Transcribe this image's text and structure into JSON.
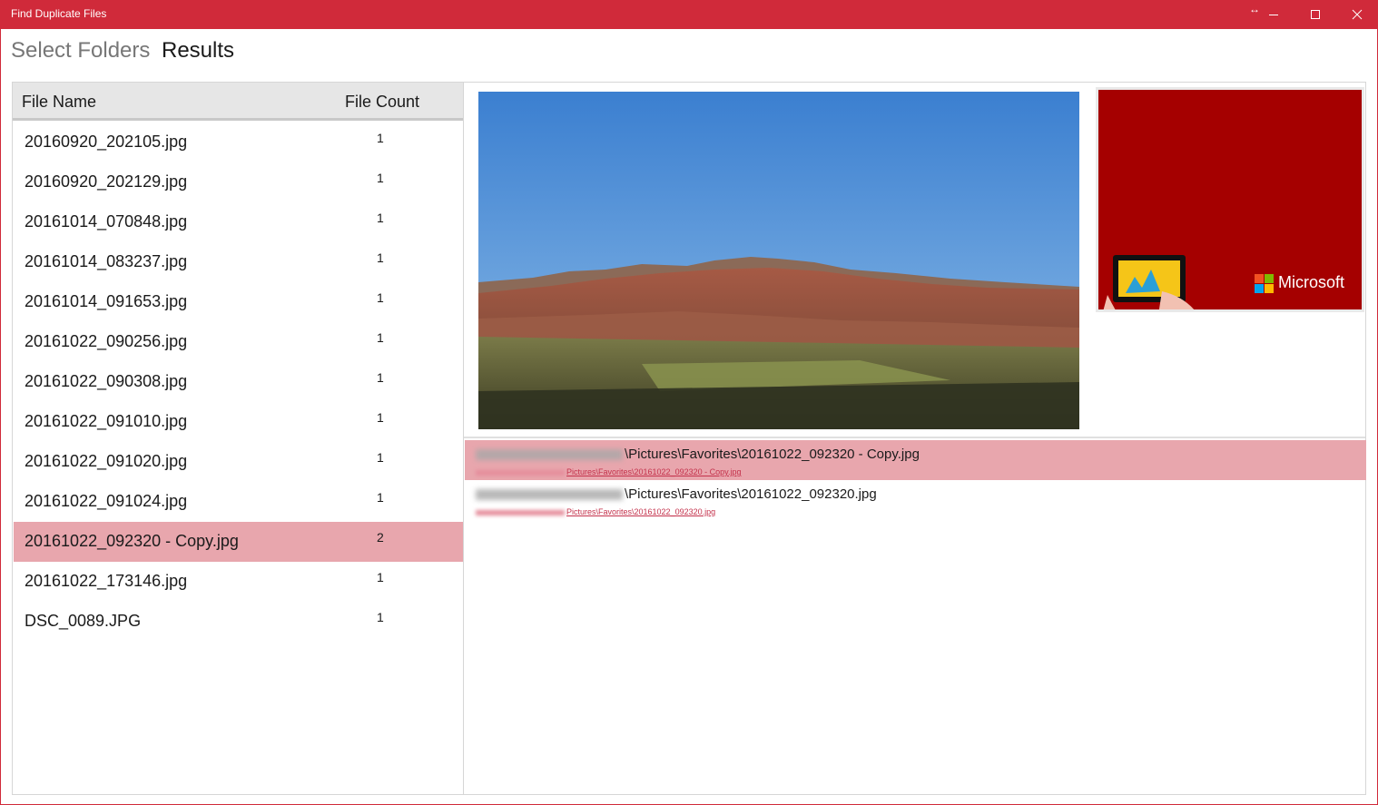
{
  "window": {
    "title": "Find Duplicate Files",
    "resize_glyph": "↔",
    "controls": [
      "minimize-icon",
      "maximize-icon",
      "close-icon"
    ],
    "accent_color": "#d02a3a"
  },
  "tabs": [
    {
      "label": "Select Folders",
      "active": false
    },
    {
      "label": "Results",
      "active": true
    }
  ],
  "file_list": {
    "headers": {
      "name": "File Name",
      "count": "File Count"
    },
    "rows": [
      {
        "name": "20160920_202105.jpg",
        "count": "1"
      },
      {
        "name": "20160920_202129.jpg",
        "count": "1"
      },
      {
        "name": "20161014_070848.jpg",
        "count": "1"
      },
      {
        "name": "20161014_083237.jpg",
        "count": "1"
      },
      {
        "name": "20161014_091653.jpg",
        "count": "1"
      },
      {
        "name": "20161022_090256.jpg",
        "count": "1"
      },
      {
        "name": "20161022_090308.jpg",
        "count": "1"
      },
      {
        "name": "20161022_091010.jpg",
        "count": "1"
      },
      {
        "name": "20161022_091020.jpg",
        "count": "1"
      },
      {
        "name": "20161022_091024.jpg",
        "count": "1"
      },
      {
        "name": "20161022_092320 - Copy.jpg",
        "count": "2"
      },
      {
        "name": "20161022_173146.jpg",
        "count": "1"
      },
      {
        "name": "DSC_0089.JPG",
        "count": "1"
      }
    ],
    "selected_index": 10,
    "selection_color": "#e8a6ad"
  },
  "preview": {
    "thumbnail_brand": "Microsoft"
  },
  "duplicate_paths": [
    {
      "path": "\\Pictures\\Favorites\\20161022_092320 - Copy.jpg",
      "link": "Pictures\\Favorites\\20161022_092320 - Copy.jpg",
      "selected": true
    },
    {
      "path": "\\Pictures\\Favorites\\20161022_092320.jpg",
      "link": "Pictures\\Favorites\\20161022_092320.jpg",
      "selected": false
    }
  ]
}
